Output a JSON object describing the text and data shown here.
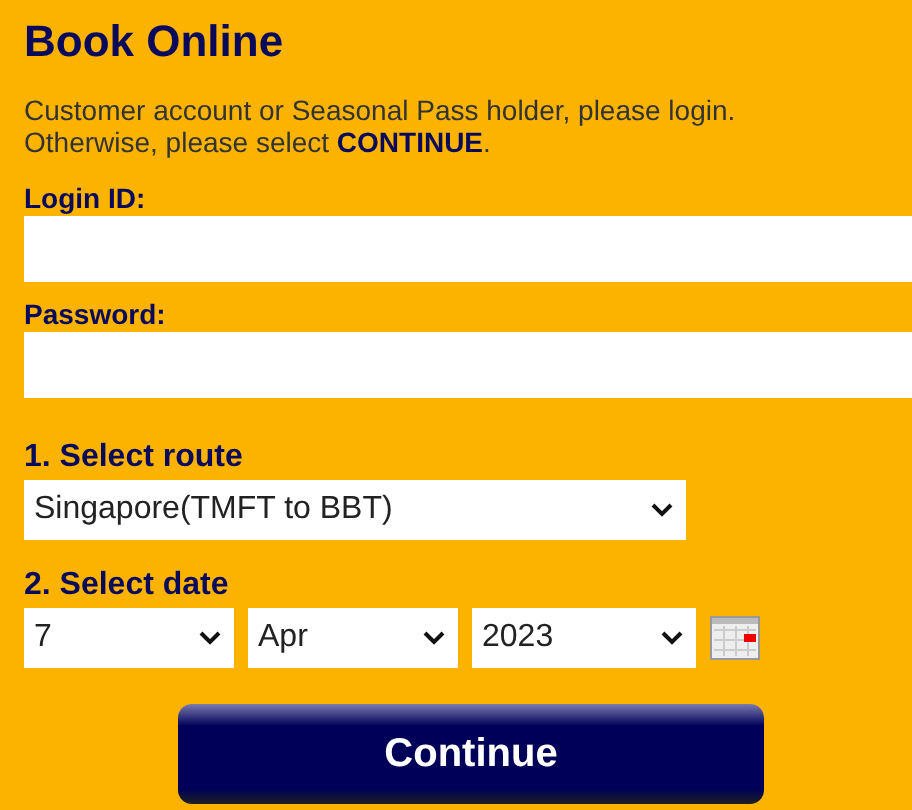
{
  "title": "Book Online",
  "intro": {
    "line_1": "Customer account or Seasonal Pass holder, please login.",
    "line_2": "Otherwise, please select **CONTINUE**."
  },
  "login_fields": [
    {
      "label": "Login ID:"
    },
    {
      "label": "Password:"
    }
  ],
  "route": {
    "label": "1. Select route",
    "value": "Singapore(TMFT to BBT)"
  },
  "date": {
    "label": "2. Select date",
    "day": "7",
    "month": "Apr",
    "year": "2023"
  },
  "button": "Continue"
}
